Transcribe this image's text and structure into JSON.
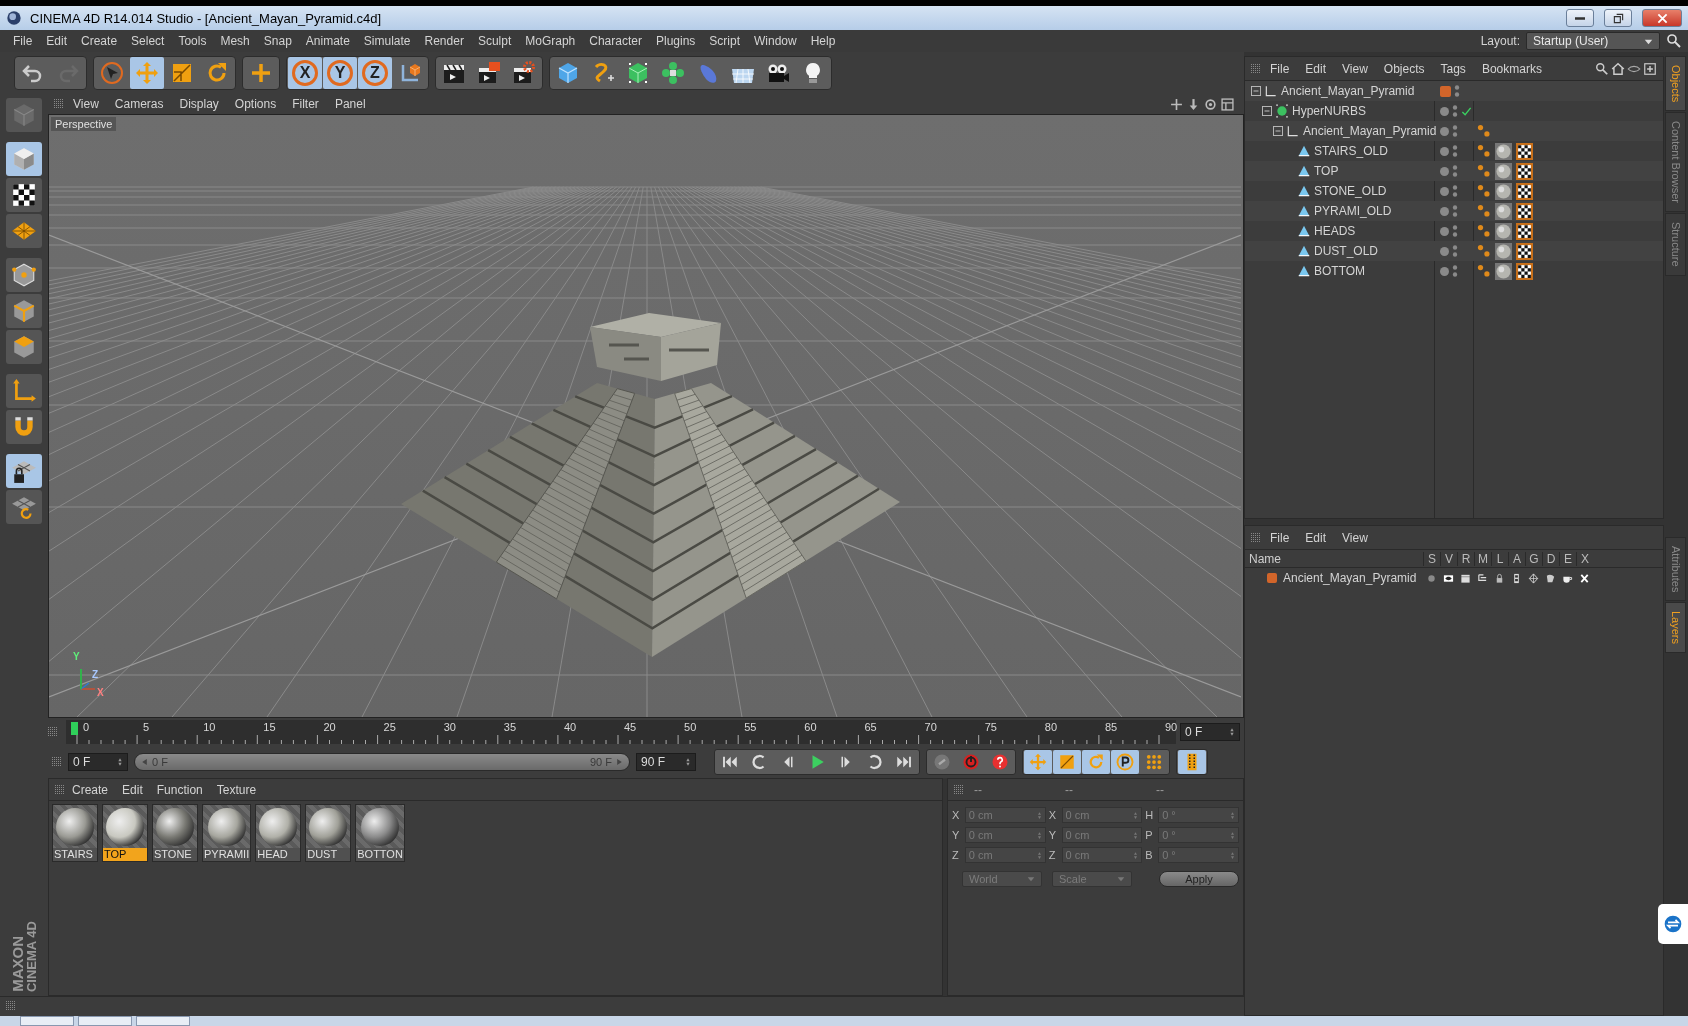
{
  "window": {
    "title": "CINEMA 4D R14.014 Studio - [Ancient_Mayan_Pyramid.c4d]"
  },
  "menu": [
    "File",
    "Edit",
    "Create",
    "Select",
    "Tools",
    "Mesh",
    "Snap",
    "Animate",
    "Simulate",
    "Render",
    "Sculpt",
    "MoGraph",
    "Character",
    "Plugins",
    "Script",
    "Window",
    "Help"
  ],
  "layout": {
    "label": "Layout:",
    "value": "Startup (User)"
  },
  "toolbar": [
    [
      {
        "kind": "undo",
        "selected": false
      },
      {
        "kind": "redo",
        "selected": false
      }
    ],
    [
      {
        "kind": "live-select",
        "selected": false
      },
      {
        "kind": "move",
        "selected": true
      },
      {
        "kind": "scale",
        "selected": false
      },
      {
        "kind": "rotate",
        "selected": false
      }
    ],
    [
      {
        "kind": "add",
        "selected": false
      }
    ],
    [
      {
        "kind": "axis",
        "label": "X",
        "selected": true
      },
      {
        "kind": "axis",
        "label": "Y",
        "selected": true
      },
      {
        "kind": "axis",
        "label": "Z",
        "selected": true
      },
      {
        "kind": "coord-system",
        "selected": false
      }
    ],
    [
      {
        "kind": "render-view",
        "selected": false
      },
      {
        "kind": "render-picture",
        "selected": false
      },
      {
        "kind": "render-settings",
        "selected": false
      }
    ],
    [
      {
        "kind": "cube",
        "selected": false
      },
      {
        "kind": "spline",
        "selected": false
      },
      {
        "kind": "subdivision",
        "selected": false
      },
      {
        "kind": "array",
        "selected": false
      },
      {
        "kind": "deformer",
        "selected": false
      },
      {
        "kind": "floor",
        "selected": false
      },
      {
        "kind": "camera",
        "selected": false
      },
      {
        "kind": "light",
        "selected": false
      }
    ]
  ],
  "left_tools": [
    {
      "kind": "view-cube",
      "selected": false
    },
    {
      "kind": "model",
      "selected": true
    },
    {
      "kind": "texture",
      "selected": false
    },
    {
      "kind": "workplane",
      "selected": false
    },
    {
      "kind": "points",
      "selected": false
    },
    {
      "kind": "edges",
      "selected": false
    },
    {
      "kind": "polygons",
      "selected": false
    },
    {
      "kind": "axis",
      "selected": false
    },
    {
      "kind": "magnet",
      "selected": false
    },
    {
      "kind": "snap-grid",
      "selected": true
    },
    {
      "kind": "grid-rotate",
      "selected": false
    }
  ],
  "logo": [
    "MAXON",
    "CINEMA 4D"
  ],
  "viewport": {
    "menu": [
      "View",
      "Cameras",
      "Display",
      "Options",
      "Filter",
      "Panel"
    ],
    "label": "Perspective",
    "axes": [
      "Y",
      "X",
      "Z"
    ]
  },
  "timeline": {
    "ticks": [
      "0",
      "5",
      "10",
      "15",
      "20",
      "25",
      "30",
      "35",
      "40",
      "45",
      "50",
      "55",
      "60",
      "65",
      "70",
      "75",
      "80",
      "85",
      "90"
    ],
    "frame": "0 F"
  },
  "playback": {
    "start": "0 F",
    "range_start": "0 F",
    "range_end": "90 F",
    "end": "90 F",
    "groups": [
      [
        {
          "kind": "first",
          "selected": false
        },
        {
          "kind": "prev-key",
          "selected": false
        },
        {
          "kind": "prev-frame",
          "selected": false
        },
        {
          "kind": "play",
          "selected": false
        },
        {
          "kind": "next-frame",
          "selected": false
        },
        {
          "kind": "next-key",
          "selected": false
        },
        {
          "kind": "last",
          "selected": false
        }
      ],
      [
        {
          "kind": "record-link",
          "selected": false
        },
        {
          "kind": "record",
          "selected": false
        },
        {
          "kind": "autokey",
          "selected": false
        }
      ],
      [
        {
          "kind": "key-position",
          "selected": true
        },
        {
          "kind": "key-scale",
          "selected": true
        },
        {
          "kind": "key-rotation",
          "selected": true
        },
        {
          "kind": "key-parameter",
          "selected": true
        },
        {
          "kind": "key-points",
          "selected": false
        }
      ],
      [
        {
          "kind": "timeline-window",
          "selected": true
        }
      ]
    ]
  },
  "materials": {
    "menu": [
      "Create",
      "Edit",
      "Function",
      "Texture"
    ],
    "items": [
      {
        "name": "STAIRS",
        "selected": false
      },
      {
        "name": "TOP",
        "selected": true
      },
      {
        "name": "STONE",
        "selected": false
      },
      {
        "name": "PYRAMII",
        "selected": false
      },
      {
        "name": "HEAD",
        "selected": false
      },
      {
        "name": "DUST",
        "selected": false
      },
      {
        "name": "BOTTON",
        "selected": false
      }
    ]
  },
  "coordinates": {
    "headers": [
      "--",
      "--",
      "--"
    ],
    "rows": [
      [
        {
          "axis": "X",
          "value": "0 cm"
        },
        {
          "axis": "X",
          "value": "0 cm"
        },
        {
          "axis": "H",
          "value": "0 °"
        }
      ],
      [
        {
          "axis": "Y",
          "value": "0 cm"
        },
        {
          "axis": "Y",
          "value": "0 cm"
        },
        {
          "axis": "P",
          "value": "0 °"
        }
      ],
      [
        {
          "axis": "Z",
          "value": "0 cm"
        },
        {
          "axis": "Z",
          "value": "0 cm"
        },
        {
          "axis": "B",
          "value": "0 °"
        }
      ]
    ],
    "mode": "World",
    "transform": "Scale",
    "apply": "Apply"
  },
  "objects": {
    "menu": [
      "File",
      "Edit",
      "View",
      "Objects",
      "Tags",
      "Bookmarks"
    ],
    "tree": [
      {
        "name": "Ancient_Mayan_Pyramid",
        "kind": "null",
        "color": "#d2652a",
        "expanded": true,
        "children": [
          {
            "name": "HyperNURBS",
            "kind": "subdivision",
            "enabled": true,
            "expanded": true,
            "children": [
              {
                "name": "Ancient_Mayan_Pyramid",
                "kind": "null",
                "expanded": true,
                "tags": [
                  {
                    "kind": "phong"
                  }
                ],
                "children": [
                  {
                    "name": "STAIRS_OLD",
                    "kind": "polygon",
                    "tags": [
                      {
                        "kind": "phong"
                      },
                      {
                        "kind": "material"
                      },
                      {
                        "kind": "uvw"
                      }
                    ]
                  },
                  {
                    "name": "TOP",
                    "kind": "polygon",
                    "tags": [
                      {
                        "kind": "phong"
                      },
                      {
                        "kind": "material"
                      },
                      {
                        "kind": "uvw"
                      }
                    ]
                  },
                  {
                    "name": "STONE_OLD",
                    "kind": "polygon",
                    "tags": [
                      {
                        "kind": "phong"
                      },
                      {
                        "kind": "material"
                      },
                      {
                        "kind": "uvw"
                      }
                    ]
                  },
                  {
                    "name": "PYRAMI_OLD",
                    "kind": "polygon",
                    "tags": [
                      {
                        "kind": "phong"
                      },
                      {
                        "kind": "material"
                      },
                      {
                        "kind": "uvw"
                      }
                    ]
                  },
                  {
                    "name": "HEADS",
                    "kind": "polygon",
                    "tags": [
                      {
                        "kind": "phong"
                      },
                      {
                        "kind": "material"
                      },
                      {
                        "kind": "uvw"
                      }
                    ]
                  },
                  {
                    "name": "DUST_OLD",
                    "kind": "polygon",
                    "tags": [
                      {
                        "kind": "phong"
                      },
                      {
                        "kind": "material"
                      },
                      {
                        "kind": "uvw"
                      }
                    ]
                  },
                  {
                    "name": "BOTTOM",
                    "kind": "polygon",
                    "tags": [
                      {
                        "kind": "phong"
                      },
                      {
                        "kind": "material"
                      },
                      {
                        "kind": "uvw"
                      }
                    ]
                  }
                ]
              }
            ]
          }
        ]
      }
    ]
  },
  "layers": {
    "menu": [
      "File",
      "Edit",
      "View"
    ],
    "columns": [
      "Name",
      "S",
      "V",
      "R",
      "M",
      "L",
      "A",
      "G",
      "D",
      "E",
      "X"
    ],
    "rows": [
      {
        "name": "Ancient_Mayan_Pyramid",
        "color": "#d2652a"
      }
    ]
  },
  "side_tabs_top": [
    {
      "label": "Objects",
      "selected": true
    },
    {
      "label": "Content Browser",
      "selected": false
    },
    {
      "label": "Structure",
      "selected": false
    }
  ],
  "side_tabs_bottom": [
    {
      "label": "Attributes",
      "selected": false
    },
    {
      "label": "Layers",
      "selected": true
    }
  ]
}
